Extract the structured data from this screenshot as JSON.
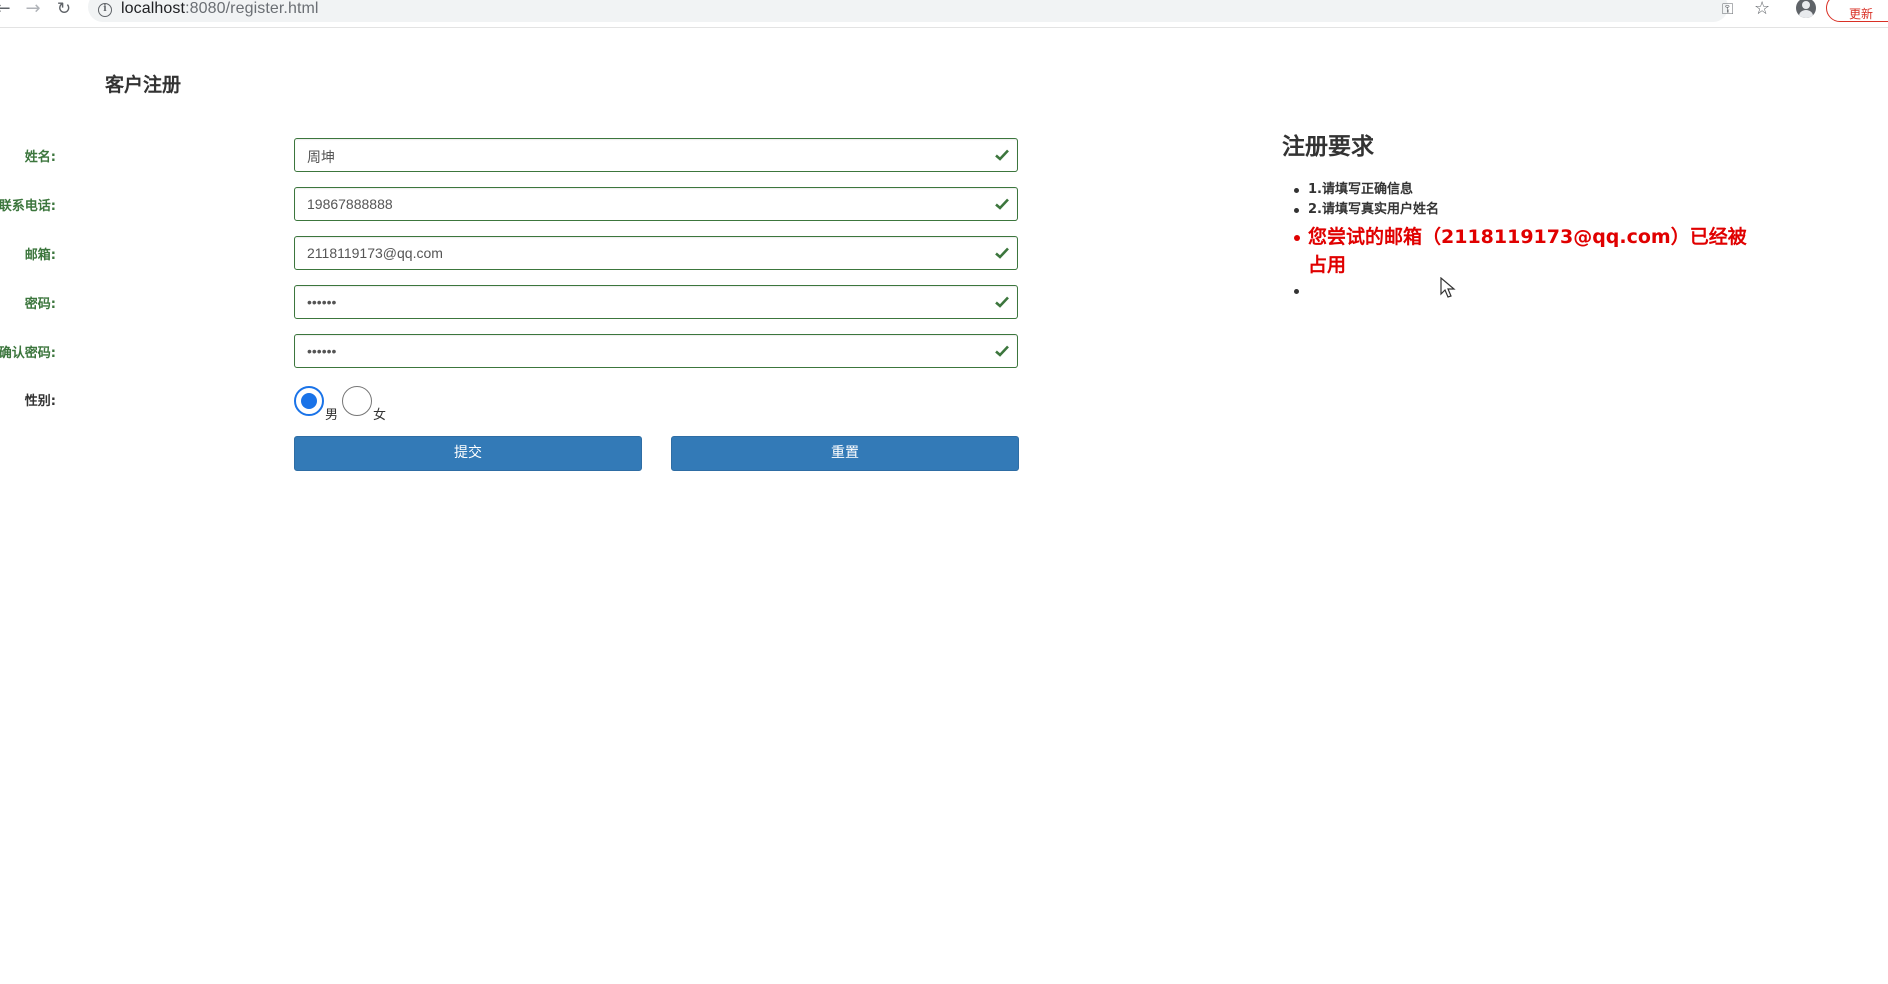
{
  "browser": {
    "url_host": "localhost",
    "url_rest": ":8080/register.html",
    "update_label": "更新",
    "update_dots": "⋮"
  },
  "page": {
    "title": "客户注册"
  },
  "form": {
    "name": {
      "label": "姓名:",
      "value": "周坤"
    },
    "phone": {
      "label": "联系电话:",
      "value": "19867888888"
    },
    "email": {
      "label": "邮箱:",
      "value": "2118119173@qq.com"
    },
    "password": {
      "label": "密码:",
      "value": "••••••"
    },
    "confirm_password": {
      "label": "确认密码:",
      "value": "••••••"
    },
    "gender": {
      "label": "性别:",
      "options": [
        {
          "label": "男",
          "checked": true
        },
        {
          "label": "女",
          "checked": false
        }
      ]
    },
    "submit_label": "提交",
    "reset_label": "重置"
  },
  "requirements": {
    "title": "注册要求",
    "items": [
      "1.请填写正确信息",
      "2.请填写真实用户姓名"
    ],
    "error": "您尝试的邮箱（2118119173@qq.com）已经被占用"
  },
  "colors": {
    "success": "#3c763d",
    "primary": "#337ab7",
    "error": "#e00000"
  }
}
